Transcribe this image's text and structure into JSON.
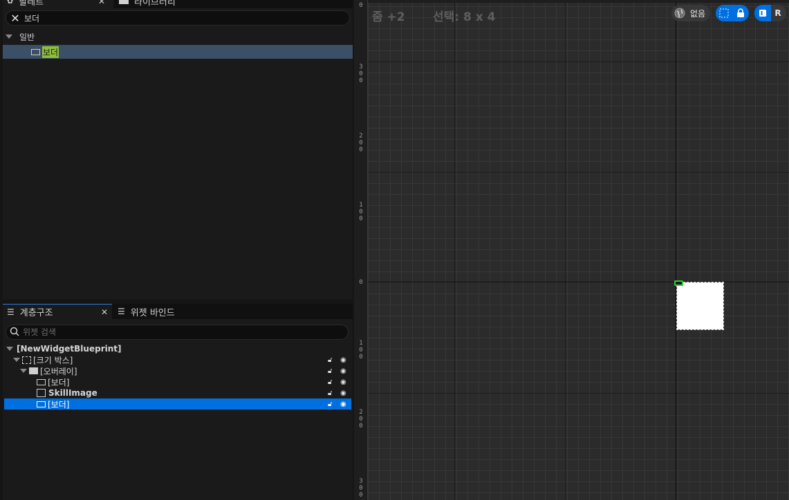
{
  "palette_panel": {
    "tabs": [
      {
        "label": "팔레트",
        "visible_fragment": "팔레트"
      },
      {
        "label": "라이브러리",
        "visible_fragment": "라이브러리"
      }
    ],
    "search_value": "보더",
    "category": "일반",
    "items": [
      {
        "label": "보더",
        "icon": "border-widget-icon"
      }
    ]
  },
  "hierarchy_panel": {
    "tabs": [
      {
        "label": "계층구조",
        "icon": "tree-list-icon"
      },
      {
        "label": "위젯 바인드",
        "icon": "list-icon"
      }
    ],
    "search_placeholder": "위젯 검색",
    "tree": [
      {
        "label": "[NewWidgetBlueprint]",
        "depth": 0
      },
      {
        "label": "[크기 박스]",
        "depth": 1,
        "icon": "size-box-icon"
      },
      {
        "label": "[오버레이]",
        "depth": 2,
        "icon": "overlay-icon"
      },
      {
        "label": "[보더]",
        "depth": 3,
        "icon": "border-widget-icon"
      },
      {
        "label": "SkillImage",
        "depth": 3,
        "icon": "image-widget-icon"
      },
      {
        "label": "[보더]",
        "depth": 3,
        "icon": "border-widget-icon",
        "selected": true
      }
    ]
  },
  "designer": {
    "zoom_label": "줌 +2",
    "selection_label": "선택: 8 x 4",
    "localization_label": "없음",
    "extra_toggle_label": "R",
    "ruler_labels": [
      "0",
      "300",
      "200",
      "100",
      "0",
      "100",
      "200",
      "300"
    ]
  },
  "colors": {
    "selection_blue": "#0070e0",
    "palette_highlight": "#3b4f66",
    "match_highlight": "#8fbf3a",
    "anchor_green": "#2fd12f"
  }
}
